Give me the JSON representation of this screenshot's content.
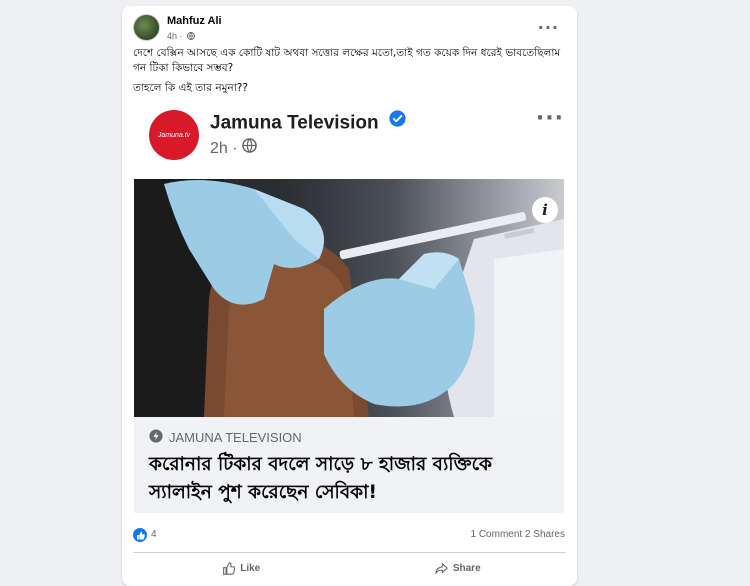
{
  "post": {
    "author": "Mahfuz Ali",
    "time": "4h",
    "privacy_icon": "globe-icon",
    "text_line1": "দেশে বেক্সিন আসছে এক কোটি ষাট অথবা সত্তোর লক্ষের মতো,তাই গত কয়েক দিন ধরেই ভাবতেছিলাম গন টিকা কিভাবে সম্ভব?",
    "text_line2": "তাহলে কি এই তার নমুনা??"
  },
  "shared": {
    "page_name": "Jamuna Television",
    "logo_text": "Jamuna.tv",
    "time": "2h",
    "domain": "JAMUNA TELEVISION",
    "headline": "করোনার টিকার বদলে সাড়ে ৮ হাজার ব্যক্তিকে স্যালাইন পুশ করেছেন সেবিকা!",
    "info_badge": "i"
  },
  "footer": {
    "reaction_count": "4",
    "comments": "1 Comment",
    "shares": "2 Shares",
    "like_label": "Like",
    "share_label": "Share"
  },
  "colors": {
    "accent": "#1877f2",
    "logo_red": "#d8192a",
    "link_bg": "#f0f2f5"
  }
}
